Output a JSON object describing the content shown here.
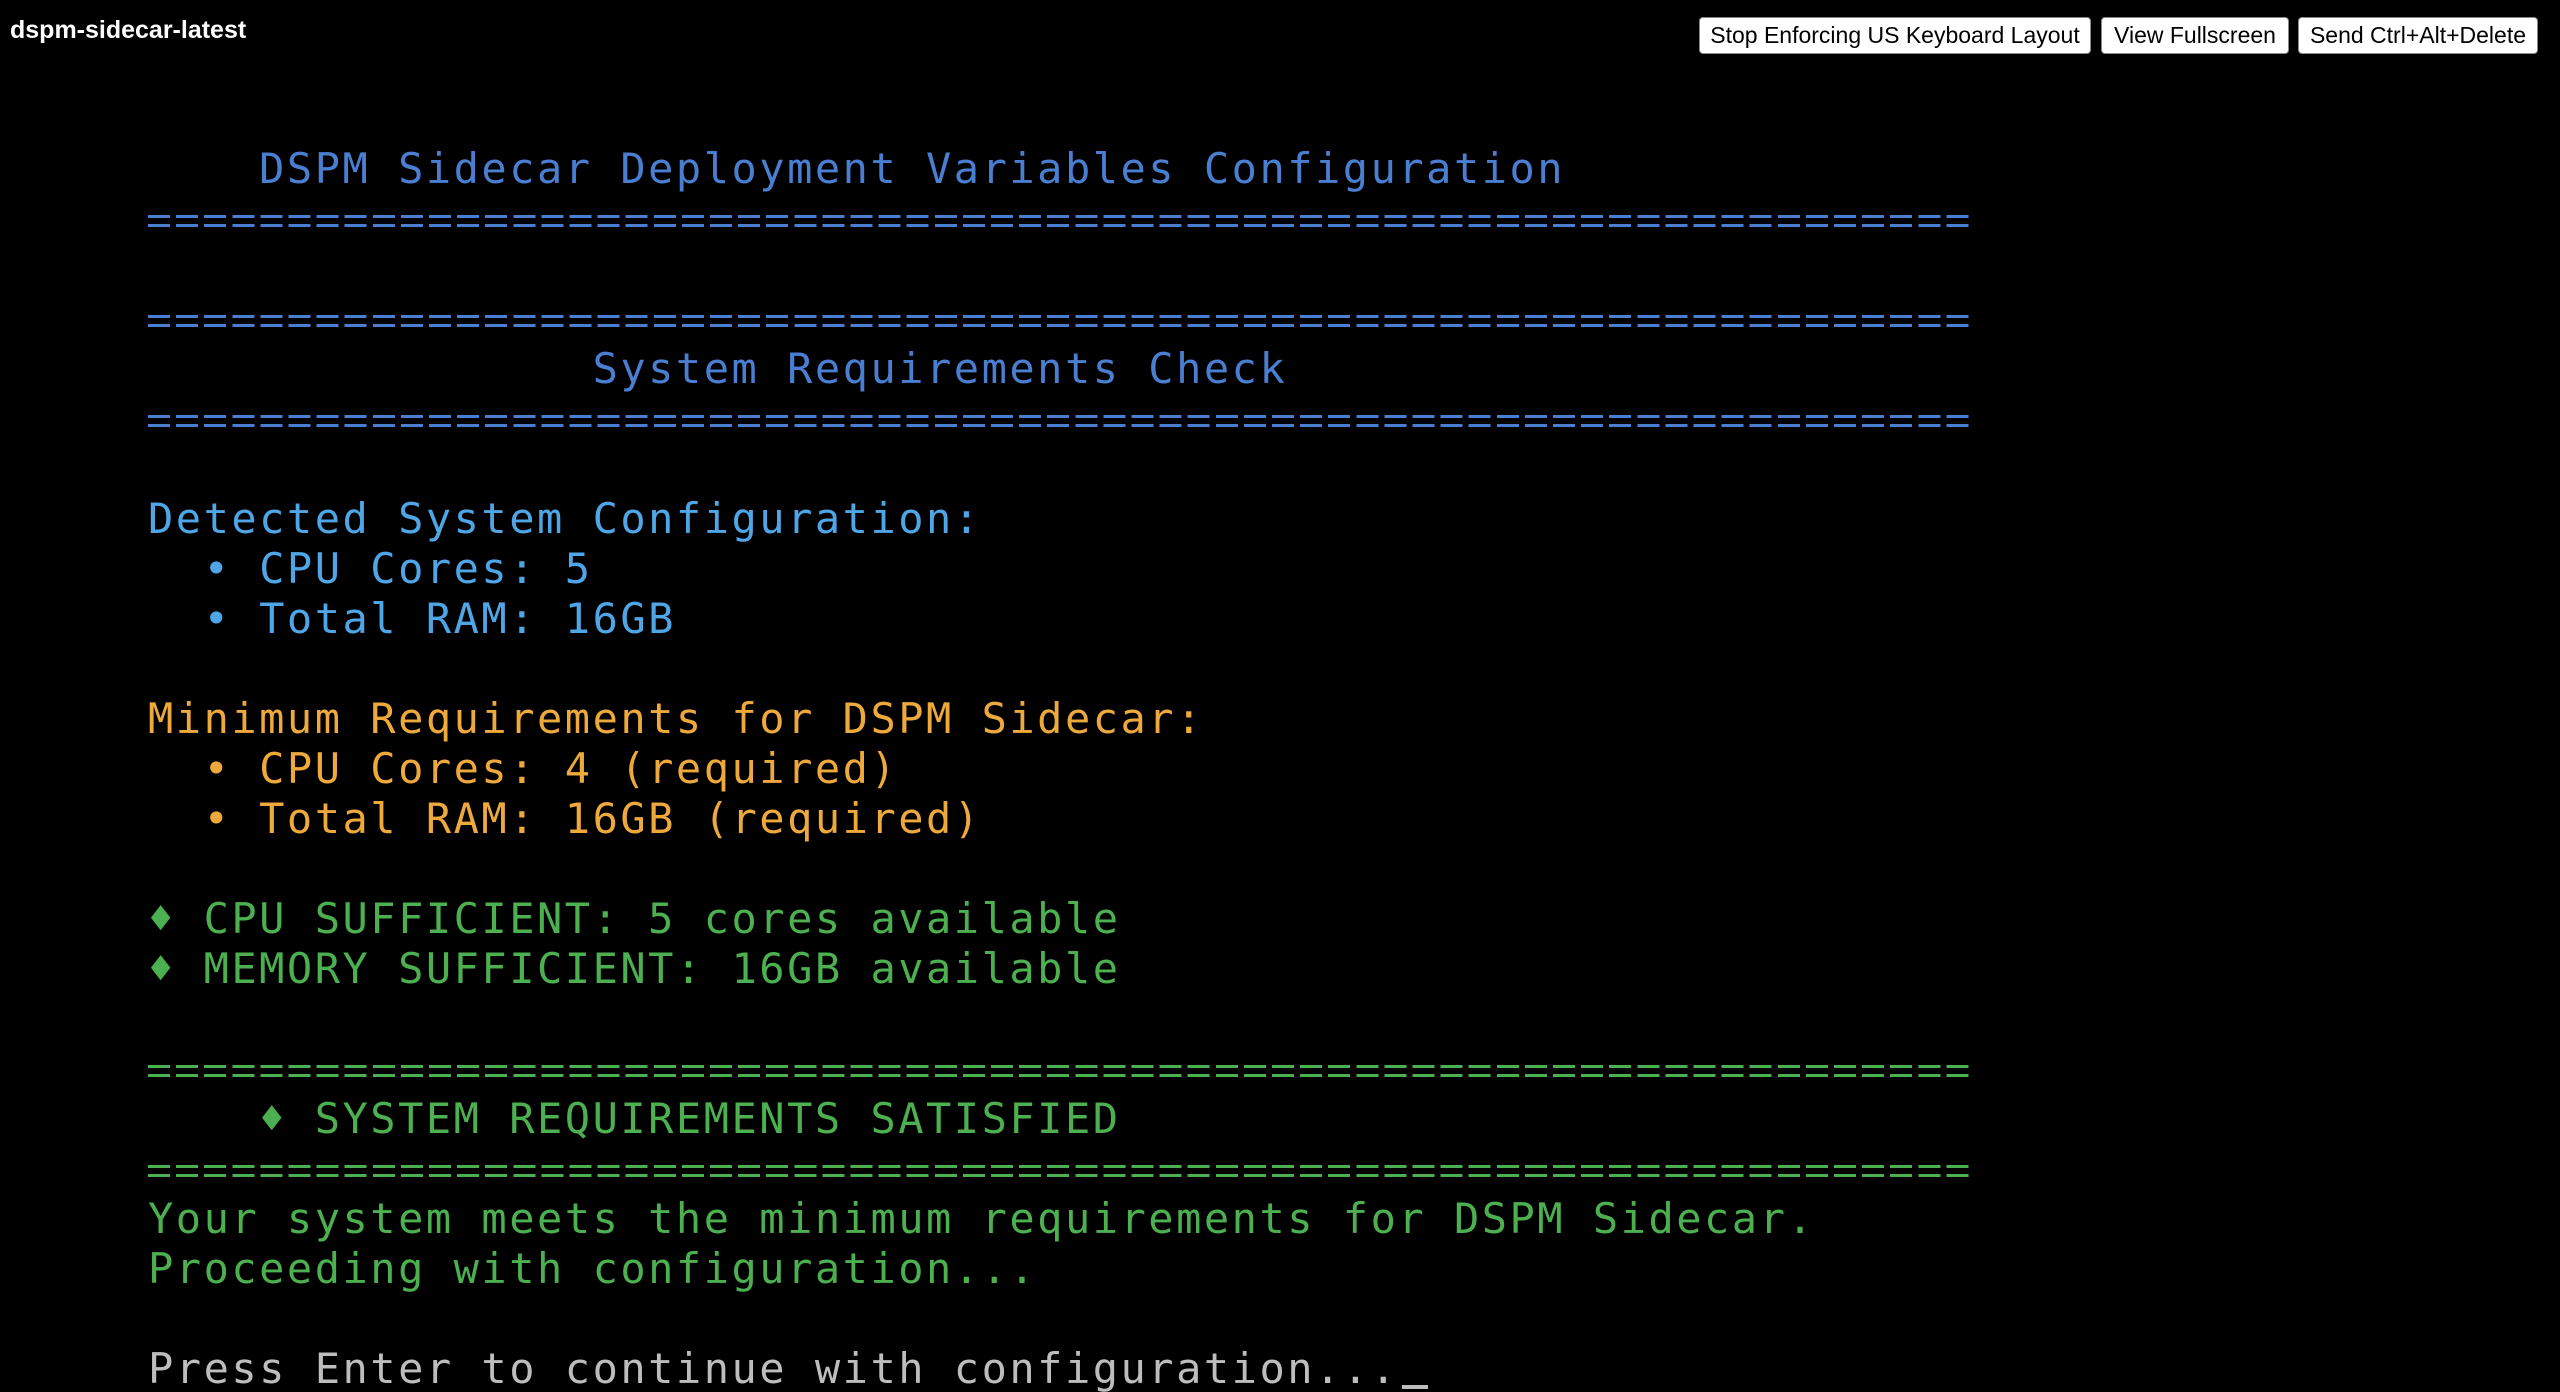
{
  "window": {
    "title": "dspm-sidecar-latest"
  },
  "toolbar": {
    "keyboard_label": "Stop Enforcing US Keyboard Layout",
    "fullscreen_label": "View Fullscreen",
    "ctrl_alt_del_label": "Send Ctrl+Alt+Delete"
  },
  "colors": {
    "background": "#000000",
    "header_blue": "#4a7ed1",
    "info_cyan": "#4fa6e6",
    "warning_yellow": "#eea93c",
    "success_green": "#4caf50",
    "prompt_grey": "#bdbdbd"
  },
  "terminal": {
    "main_title": "    DSPM Sidecar Deployment Variables Configuration",
    "section_title": "                System Requirements Check",
    "detected": {
      "heading": "Detected System Configuration:",
      "items": [
        "  • CPU Cores: 5",
        "  • Total RAM: 16GB"
      ]
    },
    "minimum": {
      "heading": "Minimum Requirements for DSPM Sidecar:",
      "items": [
        "  • CPU Cores: 4 (required)",
        "  • Total RAM: 16GB (required)"
      ]
    },
    "checks": [
      "♦ CPU SUFFICIENT: 5 cores available",
      "♦ MEMORY SUFFICIENT: 16GB available"
    ],
    "result_title": "    ♦ SYSTEM REQUIREMENTS SATISFIED",
    "result_messages": [
      "Your system meets the minimum requirements for DSPM Sidecar.",
      "Proceeding with configuration..."
    ],
    "prompt": "Press Enter to continue with configuration..."
  }
}
